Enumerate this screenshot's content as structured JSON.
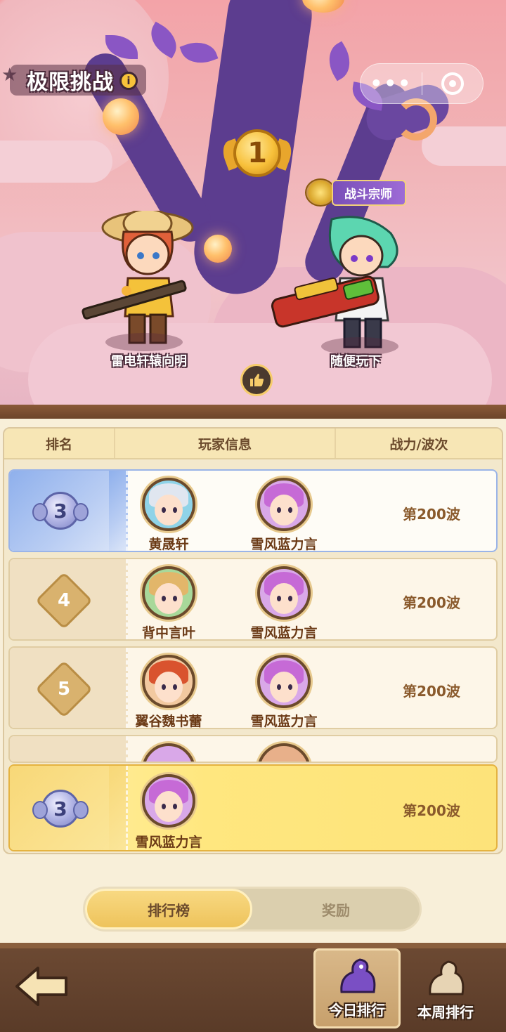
{
  "header": {
    "title": "极限挑战",
    "info_icon": "info-icon",
    "capsule": {
      "more_glyph": "•••",
      "more_icon": "more-dots-icon",
      "close_icon": "target-circle-icon"
    }
  },
  "podium": {
    "medal_number": "1",
    "title_badge": "战斗宗师",
    "left_player": "雷电轩辕向明",
    "right_player": "随便玩下",
    "like_icon": "thumbs-up-icon"
  },
  "table": {
    "headers": {
      "rank": "排名",
      "info": "玩家信息",
      "power": "战力/波次"
    },
    "rows": [
      {
        "rank": "3",
        "style": "medal",
        "player1": "黄晟轩",
        "player2": "雪风蓝力言",
        "wave": "第200波"
      },
      {
        "rank": "4",
        "style": "diamond",
        "player1": "背中言叶",
        "player2": "雪风蓝力言",
        "wave": "第200波"
      },
      {
        "rank": "5",
        "style": "diamond",
        "player1": "翼谷魏书蕾",
        "player2": "雪风蓝力言",
        "wave": "第200波"
      }
    ],
    "my_row": {
      "rank": "3",
      "player": "雪风蓝力言",
      "wave": "第200波"
    }
  },
  "tabs": {
    "leaderboard": "排行榜",
    "rewards": "奖励",
    "active": "leaderboard"
  },
  "bottom_nav": {
    "back_icon": "back-arrow-icon",
    "today": "今日排行",
    "week": "本周排行",
    "active": "today"
  },
  "colors": {
    "accent_gold": "#f7c03a",
    "panel_bg": "#f8efd9",
    "wood": "#6d4a33",
    "top3_blue": "#8fb0ec",
    "my_row_yellow": "#ffe77f"
  }
}
